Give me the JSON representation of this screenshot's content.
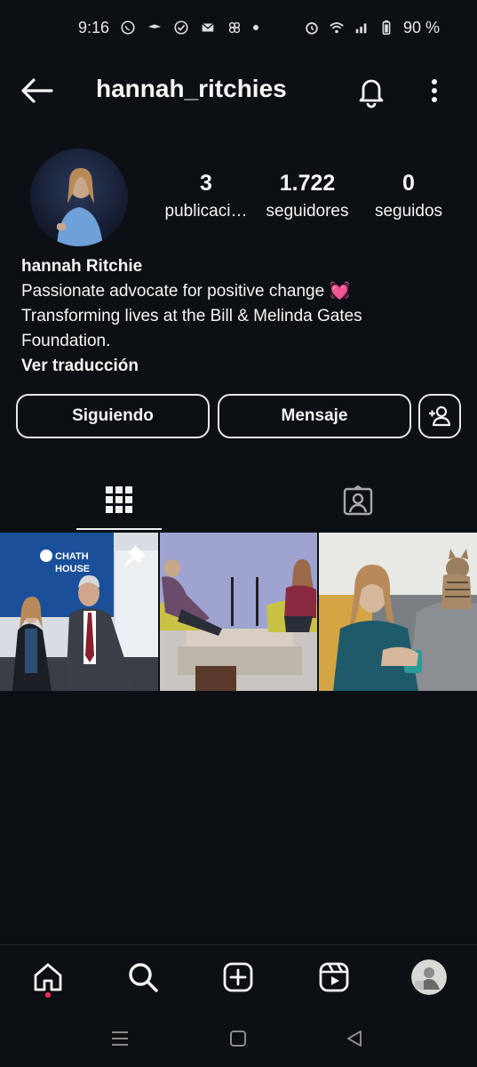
{
  "status_bar": {
    "time": "9:16",
    "battery": "90 %"
  },
  "header": {
    "username": "hannah_ritchies"
  },
  "profile": {
    "stats": [
      {
        "value": "3",
        "label": "publicaci…"
      },
      {
        "value": "1.722",
        "label": "seguidores"
      },
      {
        "value": "0",
        "label": "seguidos"
      }
    ],
    "name": "hannah Ritchie",
    "bio_line1": "Passionate advocate for positive change",
    "bio_heart": "💓",
    "bio_line2": "Transforming lives at the Bill & Melinda Gates",
    "bio_line3": "Foundation.",
    "translate_link": "Ver traducción"
  },
  "actions": {
    "following_label": "Siguiendo",
    "message_label": "Mensaje"
  },
  "posts": [
    {
      "sign_text": "CHATH HOUSE",
      "pinned": true
    },
    {
      "pinned": false
    },
    {
      "pinned": false
    }
  ],
  "colors": {
    "background": "#0c1014",
    "text": "#f5f5f5",
    "accent_dot": "#ff2f55",
    "heart": "#ff4f9a"
  }
}
